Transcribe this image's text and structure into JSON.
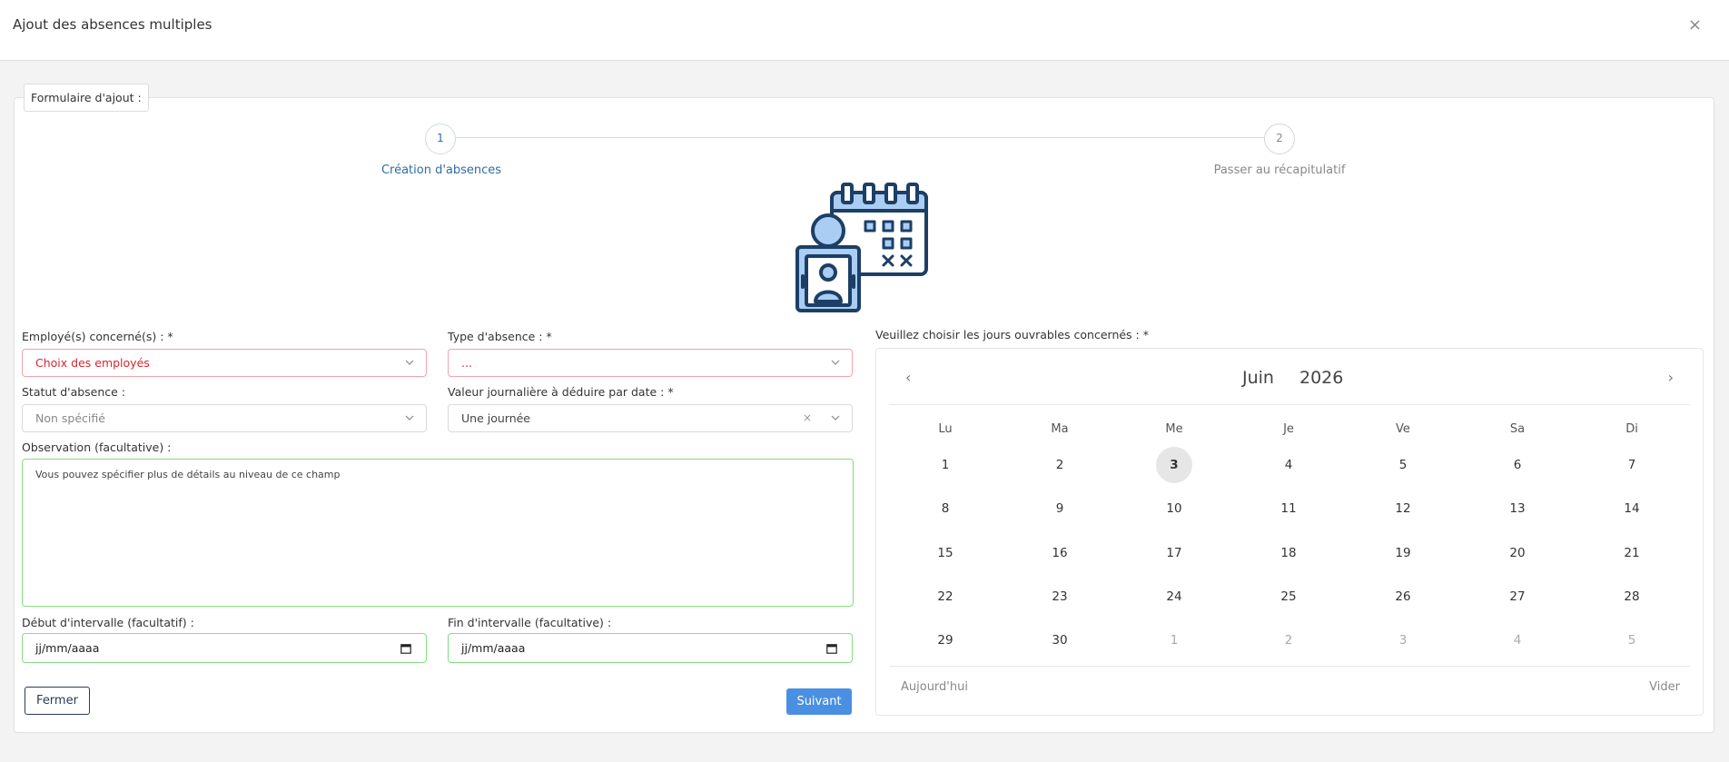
{
  "modal": {
    "title": "Ajout des absences multiples",
    "close": "×"
  },
  "form": {
    "legend": "Formulaire d'ajout :"
  },
  "steps": [
    {
      "number": "1",
      "label": "Création d'absences",
      "active": true
    },
    {
      "number": "2",
      "label": "Passer au récapitulatif",
      "active": false
    }
  ],
  "fields": {
    "employees": {
      "label": "Employé(s) concerné(s) : *",
      "placeholder": "Choix des employés"
    },
    "absence_type": {
      "label": "Type d'absence : *",
      "placeholder": "..."
    },
    "status": {
      "label": "Statut d'absence :",
      "value": "Non spécifié"
    },
    "daily_value": {
      "label": "Valeur journalière à déduire par date : *",
      "value": "Une journée",
      "clear": "×"
    },
    "observation": {
      "label": "Observation (facultative) :",
      "placeholder": "Vous pouvez spécifier plus de détails au niveau de ce champ"
    },
    "start": {
      "label": "Début d'intervalle (facultatif) :",
      "placeholder": "jj/mm/aaaa"
    },
    "end": {
      "label": "Fin d'intervalle (facultative) :",
      "placeholder": "jj/mm/aaaa"
    }
  },
  "buttons": {
    "close": "Fermer",
    "next": "Suivant"
  },
  "calendar": {
    "label": "Veuillez choisir les jours ouvrables concernés : *",
    "month": "Juin",
    "year": "2026",
    "prev": "‹",
    "next": "›",
    "weekdays": [
      "Lu",
      "Ma",
      "Me",
      "Je",
      "Ve",
      "Sa",
      "Di"
    ],
    "weeks": [
      [
        "1",
        "2",
        "3",
        "4",
        "5",
        "6",
        "7"
      ],
      [
        "8",
        "9",
        "10",
        "11",
        "12",
        "13",
        "14"
      ],
      [
        "15",
        "16",
        "17",
        "18",
        "19",
        "20",
        "21"
      ],
      [
        "22",
        "23",
        "24",
        "25",
        "26",
        "27",
        "28"
      ],
      [
        "29",
        "30",
        "1",
        "2",
        "3",
        "4",
        "5"
      ]
    ],
    "today_day": "3",
    "next_month_from_index": 2,
    "today_btn": "Aujourd'hui",
    "clear_btn": "Vider"
  },
  "colors": {
    "accent": "#4a90e2",
    "step_active": "#2e6da4",
    "error_border": "#f2a4ac",
    "valid_border": "#85dc85",
    "icon_fill": "#a9cdf3",
    "icon_stroke": "#1d3f66"
  },
  "icons": {
    "illustration": "employee-calendar-icon"
  }
}
